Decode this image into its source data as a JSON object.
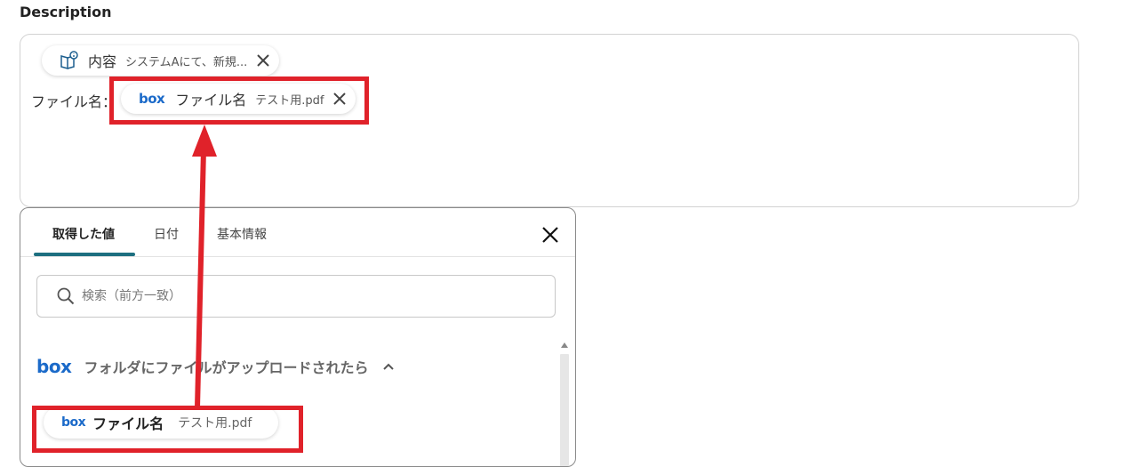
{
  "field": {
    "label": "Description"
  },
  "editor": {
    "chip1": {
      "name": "内容",
      "value": "システムAにて、新規..."
    },
    "prefix_text": "ファイル名：",
    "chip2": {
      "logo": "box",
      "name": "ファイル名",
      "value": "テスト用.pdf"
    }
  },
  "panel": {
    "tabs": [
      {
        "label": "取得した値"
      },
      {
        "label": "日付"
      },
      {
        "label": "基本情報"
      }
    ],
    "search": {
      "placeholder": "検索（前方一致）"
    },
    "section": {
      "logo": "box",
      "title": "フォルダにファイルがアップロードされたら"
    },
    "item": {
      "logo": "box",
      "name": "ファイル名",
      "value": "テスト用.pdf"
    }
  },
  "colors": {
    "highlight": "#e0222a",
    "box_brand": "#1b6ac9",
    "tab_accent": "#1d6f80"
  },
  "icons": [
    "book-info-icon",
    "close-icon",
    "search-icon",
    "chevron-up-icon",
    "box-logo-icon"
  ]
}
